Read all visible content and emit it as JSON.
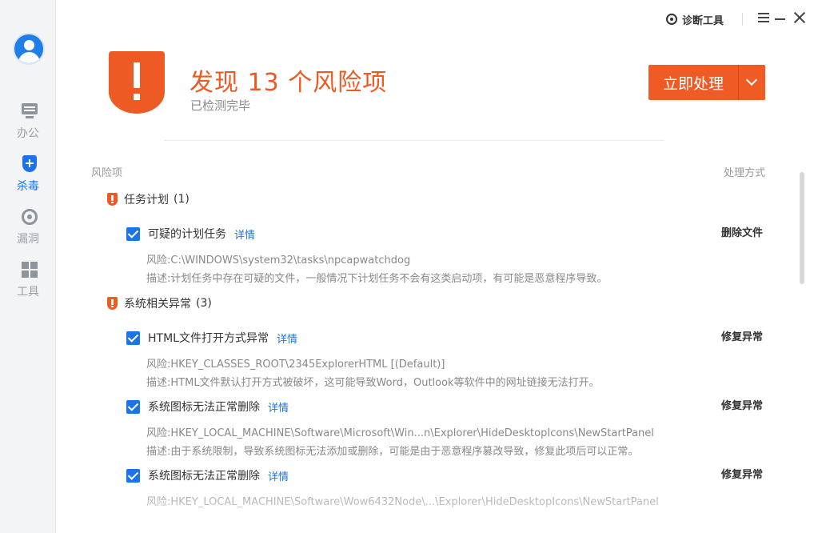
{
  "sidebar": {
    "items": [
      {
        "label": "办公",
        "icon": "computer-icon"
      },
      {
        "label": "杀毒",
        "icon": "shield-plus-icon",
        "active": true
      },
      {
        "label": "漏洞",
        "icon": "radar-icon"
      },
      {
        "label": "工具",
        "icon": "tools-grid-icon"
      }
    ]
  },
  "titlebar": {
    "diagnose_label": "诊断工具"
  },
  "header": {
    "title": "发现 13 个风险项",
    "subtitle": "已检测完毕",
    "action_label": "立即处理"
  },
  "table": {
    "col_risk": "风险项",
    "col_action": "处理方式"
  },
  "groups": [
    {
      "name": "任务计划",
      "count": "(1)",
      "items": [
        {
          "name": "可疑的计划任务",
          "link": "详情",
          "action": "删除文件",
          "risk": "风险:C:\\WINDOWS\\system32\\tasks\\npcapwatchdog",
          "desc": "描述:计划任务中存在可疑的文件，一般情况下计划任务不会有这类启动项，有可能是恶意程序导致。"
        }
      ]
    },
    {
      "name": "系统相关异常",
      "count": "(3)",
      "items": [
        {
          "name": "HTML文件打开方式异常",
          "link": "详情",
          "action": "修复异常",
          "risk": "风险:HKEY_CLASSES_ROOT\\2345ExplorerHTML [(Default)]",
          "desc": "描述:HTML文件默认打开方式被破坏，这可能导致Word，Outlook等软件中的网址链接无法打开。"
        },
        {
          "name": "系统图标无法正常删除",
          "link": "详情",
          "action": "修复异常",
          "risk": "风险:HKEY_LOCAL_MACHINE\\Software\\Microsoft\\Win...n\\Explorer\\HideDesktopIcons\\NewStartPanel",
          "desc": "描述:由于系统限制，导致系统图标无法添加或删除，可能是由于恶意程序篡改导致，修复此项后可以正常。"
        },
        {
          "name": "系统图标无法正常删除",
          "link": "详情",
          "action": "修复异常",
          "risk": "风险:HKEY_LOCAL_MACHINE\\Software\\Wow6432Node\\...\\Explorer\\HideDesktopIcons\\NewStartPanel"
        }
      ]
    }
  ],
  "colors": {
    "accent_orange": "#ee5a24",
    "accent_blue": "#1a73e8"
  }
}
